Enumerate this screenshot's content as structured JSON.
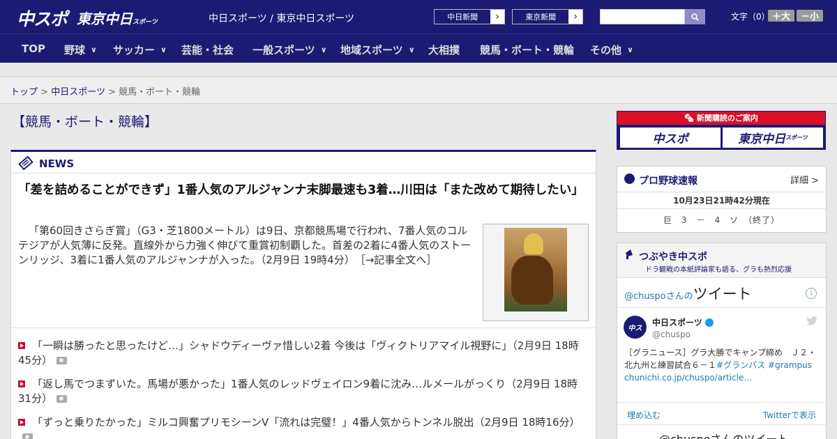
{
  "header": {
    "logo_main": "中スポ",
    "logo_tokyo": "東京中日",
    "logo_tokyo_small": "スポーツ",
    "site_title": "中日スポーツ / 東京中日スポーツ",
    "paper_links": [
      {
        "label": "中日新聞"
      },
      {
        "label": "東京新聞"
      }
    ],
    "search": {
      "placeholder": ""
    },
    "font_size": {
      "label": "文字（0）",
      "bigger": "＋大",
      "smaller": "－小"
    }
  },
  "nav": {
    "items": [
      {
        "label": "TOP",
        "has_menu": false
      },
      {
        "label": "野球",
        "has_menu": true
      },
      {
        "label": "サッカー",
        "has_menu": true
      },
      {
        "label": "芸能・社会",
        "has_menu": false
      },
      {
        "label": "一般スポーツ",
        "has_menu": true
      },
      {
        "label": "地域スポーツ",
        "has_menu": true
      },
      {
        "label": "大相撲",
        "has_menu": false
      },
      {
        "label": "競馬・ボート・競輪",
        "has_menu": false
      },
      {
        "label": "その他",
        "has_menu": true
      }
    ]
  },
  "breadcrumb": {
    "home": "トップ",
    "parent": "中日スポーツ",
    "current": "競馬・ボート・競輪",
    "sep": ">"
  },
  "page_title": "【競馬・ボート・競輪】",
  "news": {
    "heading": "NEWS",
    "lead": {
      "title": "「差を詰めることができず」1番人気のアルジャンナ末脚最速も3着…川田は「また改めて期待したい」",
      "body": "「第60回きさらぎ賞」（G3・芝1800メートル）は9日、京都競馬場で行われ、7番人気のコルテジアが人気薄に反発。直線外から力強く伸びて重賞初制覇した。首差の2着に4番人気のストーンリッジ、3着に1番人気のアルジャンナが入った。（2月9日 19時4分）　［→記事全文へ］"
    },
    "items": [
      {
        "text": "「一瞬は勝ったと思ったけど…」シャドウディーヴァ惜しい2着 今後は「ヴィクトリアマイル視野に」（2月9日 18時45分）"
      },
      {
        "text": "「返し馬でつまずいた。馬場が悪かった」1番人気のレッドヴェイロン9着に沈み…ルメールがっくり（2月9日 18時31分）"
      },
      {
        "text": "「ずっと乗りたかった」ミルコ興奮プリモシーンV「流れは完璧！」4番人気からトンネル脱出（2月9日 18時16分）"
      }
    ]
  },
  "subscribe": {
    "label": "新聞購読のご案内",
    "btn1": "中スポ",
    "btn2": "東京中日",
    "btn2_small": "スポーツ"
  },
  "baseball": {
    "title": "プロ野球速報",
    "more": "詳細 >",
    "time": "10月23日21時42分現在",
    "score": "巨　3　－　4　ソ　（終了）"
  },
  "tweets": {
    "title": "つぶやき中スポ",
    "subtitle": "ドラ観戦の本紙評論家も語る、グラも熱烈応援",
    "handle_head": "@chuspoさんの",
    "tweets_word": "ツイート",
    "info": "i",
    "avatar": "中ス",
    "name": "中日スポーツ",
    "handle": "@chuspo",
    "text_plain": "［グラニュース］グラ大勝でキャンプ締め　Ｊ２・北九州と練習試合６－１",
    "hashtag1": "#グランパス",
    "hashtag2": "#grampus",
    "link": "chunichi.co.jp/chuspo/article…",
    "embed": "埋め込む",
    "view": "Twitterで表示",
    "more_tweets": "@chuspoさんのツイート"
  },
  "colors": {
    "brand_navy": "#1c1a72",
    "accent_red": "#d8102a",
    "link_blue": "#1c7ab5"
  }
}
